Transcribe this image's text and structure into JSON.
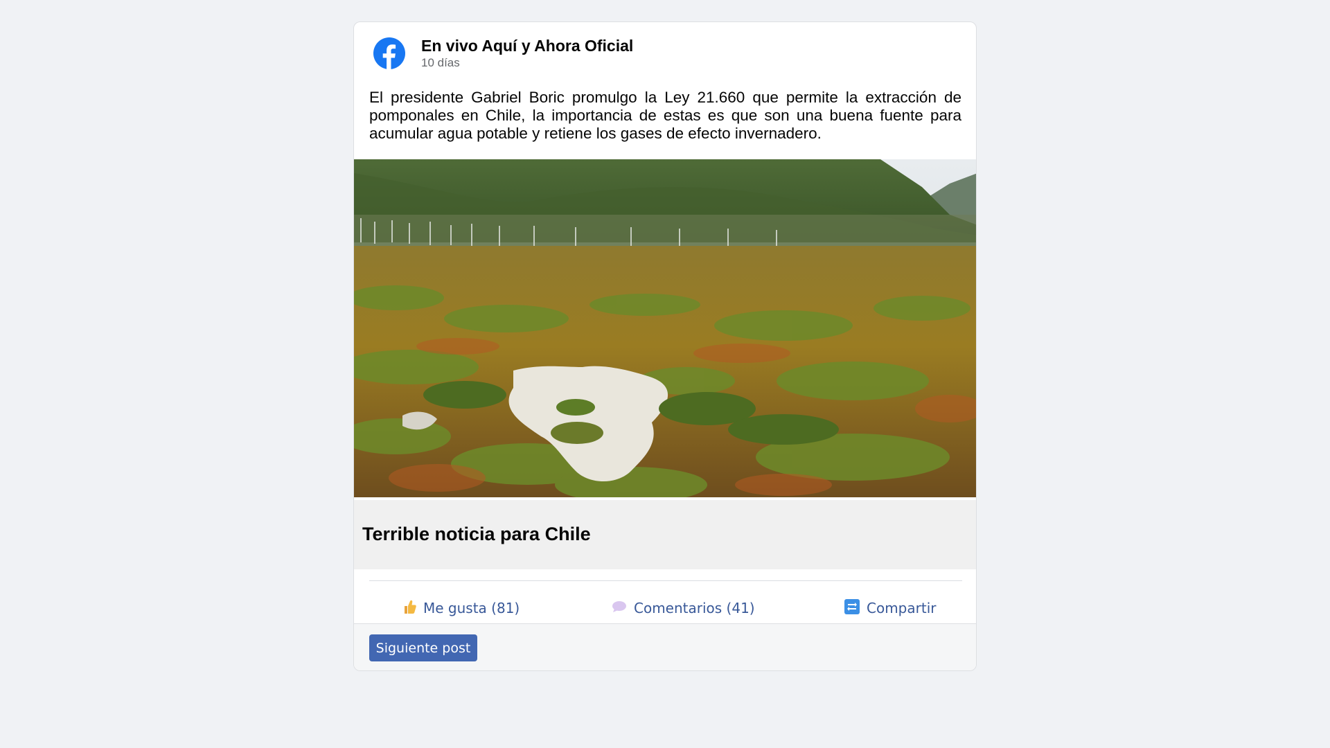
{
  "post": {
    "page_name": "En vivo Aquí y Ahora Oficial",
    "time": "10 días",
    "text": "El presidente Gabriel Boric promulgo la Ley 21.660 que permite la extracción de pomponales en Chile, la importancia de estas es que son una buena fuente para acumular agua potable y retiene los gases de efecto invernadero.",
    "logo_icon": "facebook-logo-icon",
    "logo_color": "#1877f2"
  },
  "link_preview": {
    "title": "Terrible noticia para Chile"
  },
  "actions": {
    "like_label": "Me gusta (81)",
    "comment_label": "Comentarios (41)",
    "share_label": "Compartir",
    "link_color": "#385898"
  },
  "footer": {
    "next_button_label": "Siguiente post",
    "button_color": "#4267b2"
  }
}
